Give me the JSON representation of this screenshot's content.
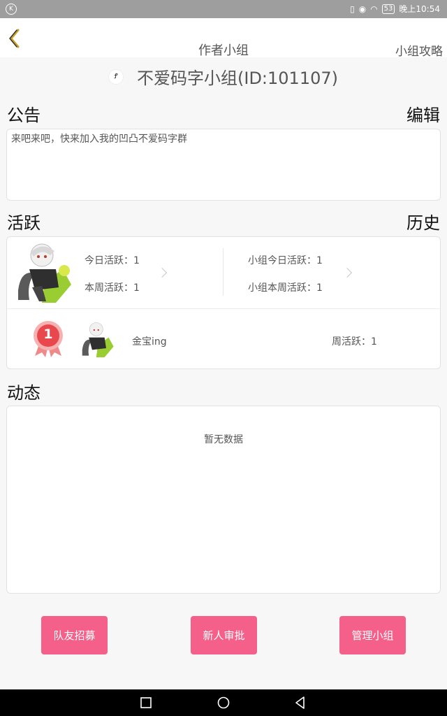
{
  "status_bar": {
    "left_icon": "K",
    "battery": "53",
    "time": "晚上10:54"
  },
  "header": {
    "title": "作者小组",
    "guide_label": "小组攻略"
  },
  "group": {
    "icon_text": "Ꝭ",
    "name": "不爱码字小组(ID:101107)"
  },
  "notice": {
    "section_label": "公告",
    "edit_label": "编辑",
    "text": "来吧来吧，快来加入我的凹凸不爱码字群"
  },
  "activity": {
    "section_label": "活跃",
    "history_label": "历史",
    "today_active": "今日活跃：1",
    "week_active": "本周活跃：1",
    "group_today_active": "小组今日活跃：1",
    "group_week_active": "小组本周活跃：1",
    "rank": {
      "badge": "1",
      "user_name": "金宝ing",
      "week_active": "周活跃：1"
    }
  },
  "dynamics": {
    "section_label": "动态",
    "empty_text": "暂无数据"
  },
  "buttons": {
    "recruit": "队友招募",
    "approve": "新人审批",
    "manage": "管理小组"
  },
  "colors": {
    "accent": "#f5608a",
    "back_arrow": "#c9a227",
    "rank_badge": "#e8484d"
  }
}
